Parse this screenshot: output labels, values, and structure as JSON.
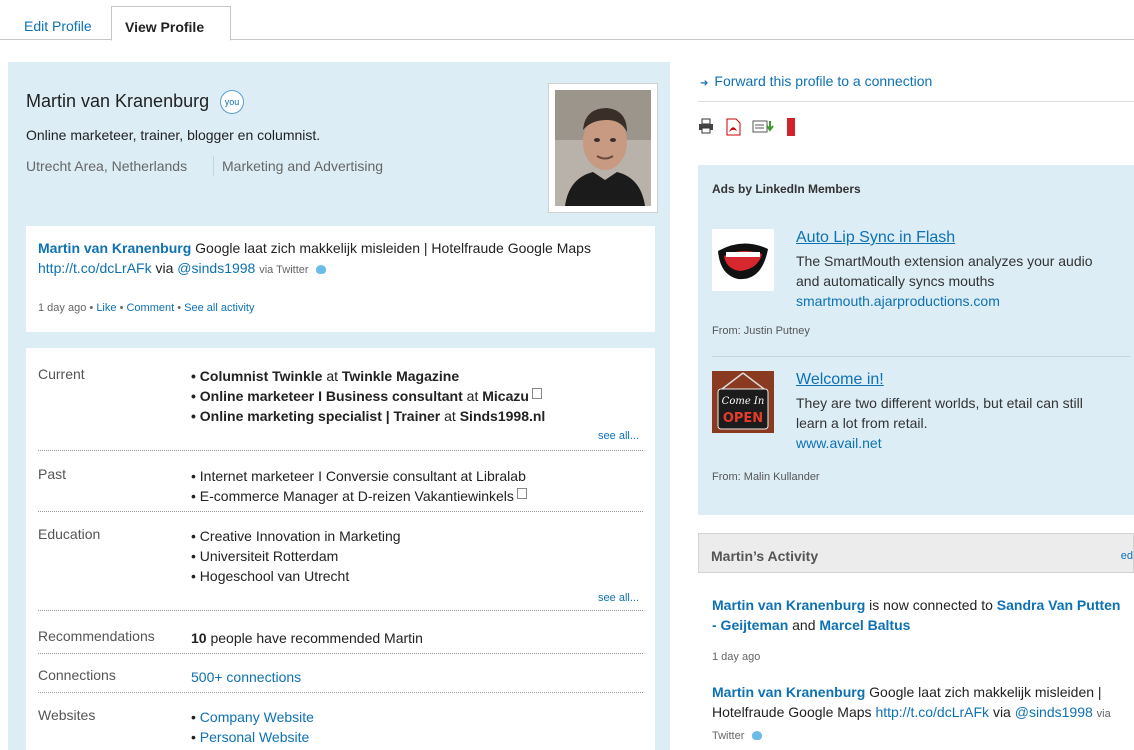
{
  "tabs": {
    "edit": "Edit Profile",
    "view": "View Profile"
  },
  "profile": {
    "name": "Martin van Kranenburg",
    "badge": "you",
    "headline": "Online marketeer, trainer, blogger en columnist.",
    "location": "Utrecht Area, Netherlands",
    "industry": "Marketing and Advertising"
  },
  "activity_box": {
    "author": "Martin van Kranenburg",
    "text": "Google laat zich makkelijk misleiden | Hotelfraude Google Maps",
    "link": "http://t.co/dcLrAFk",
    "via": "via",
    "handle": "@sinds1998",
    "via_source": "via Twitter",
    "time": "1 day ago",
    "sep": "•",
    "like": "Like",
    "comment": "Comment",
    "see_all": "See all activity"
  },
  "summary": {
    "current_label": "Current",
    "current": [
      {
        "role": "Columnist Twinkle",
        "at": "at",
        "org": "Twinkle Magazine"
      },
      {
        "role": "Online marketeer I Business consultant",
        "at": "at",
        "org": "Micazu"
      },
      {
        "role": "Online marketing specialist | Trainer",
        "at": "at",
        "org": "Sinds1998.nl"
      }
    ],
    "see_all": "see all...",
    "past_label": "Past",
    "past": [
      "Internet marketeer I Conversie consultant at Libralab",
      "E-commerce Manager at D-reizen Vakantiewinkels"
    ],
    "education_label": "Education",
    "education": [
      "Creative Innovation in Marketing",
      "Universiteit Rotterdam",
      "Hogeschool van Utrecht"
    ],
    "recommendations_label": "Recommendations",
    "recommendations_count": "10",
    "recommendations_text": "people have recommended Martin",
    "connections_label": "Connections",
    "connections": "500+ connections",
    "websites_label": "Websites",
    "websites": [
      "Company Website",
      "Personal Website"
    ]
  },
  "right": {
    "forward": "Forward this profile to a connection",
    "ads_title": "Ads by LinkedIn Members",
    "ads": [
      {
        "title": "Auto Lip Sync in Flash",
        "body": "The SmartMouth extension analyzes your audio and automatically syncs mouths",
        "url": "smartmouth.ajarproductions.com",
        "from": "From: Justin Putney"
      },
      {
        "title": "Welcome in!",
        "body": "They are two different worlds, but etail can still learn a lot from retail.",
        "url": "www.avail.net",
        "from": "From: Malin Kullander",
        "image_text_1": "Come In",
        "image_text_2": "OPEN"
      }
    ],
    "activity_title": "Martin’s Activity",
    "activity_edit": "ed",
    "feed1_author": "Martin van Kranenburg",
    "feed1_text": "is now connected to",
    "feed1_person1": "Sandra Van Putten - Geijteman",
    "feed1_and": "and",
    "feed1_person2": "Marcel Baltus",
    "feed1_time": "1 day ago",
    "feed2_author": "Martin van Kranenburg",
    "feed2_text": "Google laat zich makkelijk misleiden | Hotelfraude Google Maps",
    "feed2_link": "http://t.co/dcLrAFk",
    "feed2_via": "via",
    "feed2_handle": "@sinds1998",
    "feed2_source": "via Twitter"
  },
  "icons": {
    "twitter": "twitter-bird-icon",
    "print": "print-icon",
    "pdf": "pdf-icon",
    "vcard": "vcard-download-icon",
    "bookmark": "bookmark-icon"
  }
}
